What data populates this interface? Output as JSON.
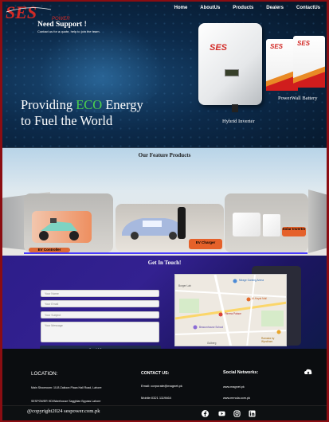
{
  "nav": {
    "logo": "SES",
    "logo_tagline": "POWER",
    "items": [
      "Home",
      "AboutUs",
      "Products",
      "Dealers",
      "ContactUs"
    ]
  },
  "hero": {
    "title_pre": "Providing ",
    "title_eco": "ECO",
    "title_post": " Energy",
    "title_line2": "to Fuel the World",
    "product_brand": "SES",
    "caption_inverter": "Hybrid Inverter",
    "caption_battery": "PowerWall Battery"
  },
  "features": {
    "heading": "Our Feature Products",
    "badge1": "EV Controller",
    "badge2": "EV Charger",
    "badge3": "Solar Inverter"
  },
  "support": {
    "heading": "Get In Touch!",
    "need_title": "Need Support !",
    "subtitle": "Contact us for a quote, help to join the team.",
    "placeholder_name": "Your Name",
    "placeholder_email": "Your Email",
    "placeholder_subject": "Your Subject",
    "placeholder_message": "Your Message",
    "send_label": "Send Message"
  },
  "map": {
    "label_gaming": "Mirage Gaming Arena",
    "label_market": "Al-Hayat Mall",
    "label_ekinden": "Fitness Palace",
    "label_ramada": "Ramada by Wyndham",
    "label_school": "Beaconhouse School",
    "label_burger": "Burger Lab",
    "label_area": "Gulberg"
  },
  "footer": {
    "location_heading": "LOCATION:",
    "address1": "Main Showroom: 10-B Zaitoon Plaza Hall Road, Lahore",
    "address2": "SESPOWER HD/Warehouse Sagghian Bypass Lahore",
    "contact_heading": "CONTACT US:",
    "email": "Email: corporate@magnet.pk",
    "mobile": "Mobile:0321 1119464",
    "social_heading": "Social Networks:",
    "site1": "www.magnet.pk",
    "site2": "www.mrnola.com.pk",
    "copyright": "@copyright2024 sespower.com.pk"
  },
  "colors": {
    "brand_red": "#d22a26",
    "eco_green": "#4cd14c",
    "border_red": "#8b0d12",
    "footer_bg": "#0b0d10"
  },
  "icons": [
    "facebook-icon",
    "youtube-icon",
    "instagram-icon",
    "linkedin-icon",
    "scroll-up-icon"
  ]
}
